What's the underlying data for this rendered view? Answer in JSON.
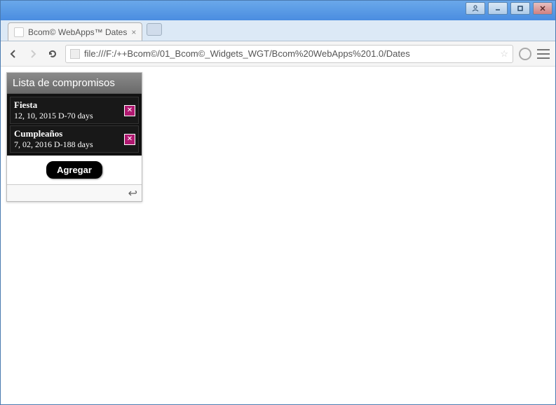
{
  "browser": {
    "tab_title": "Bcom© WebApps™ Dates",
    "url": "file:///F:/++Bcom©/01_Bcom©_Widgets_WGT/Bcom%20WebApps%201.0/Dates"
  },
  "widget": {
    "header": "Lista de compromisos",
    "items": [
      {
        "title": "Fiesta",
        "date_text": "12, 10, 2015 D-70 days"
      },
      {
        "title": "Cumpleaños",
        "date_text": "7, 02, 2016 D-188 days"
      }
    ],
    "add_label": "Agregar"
  }
}
